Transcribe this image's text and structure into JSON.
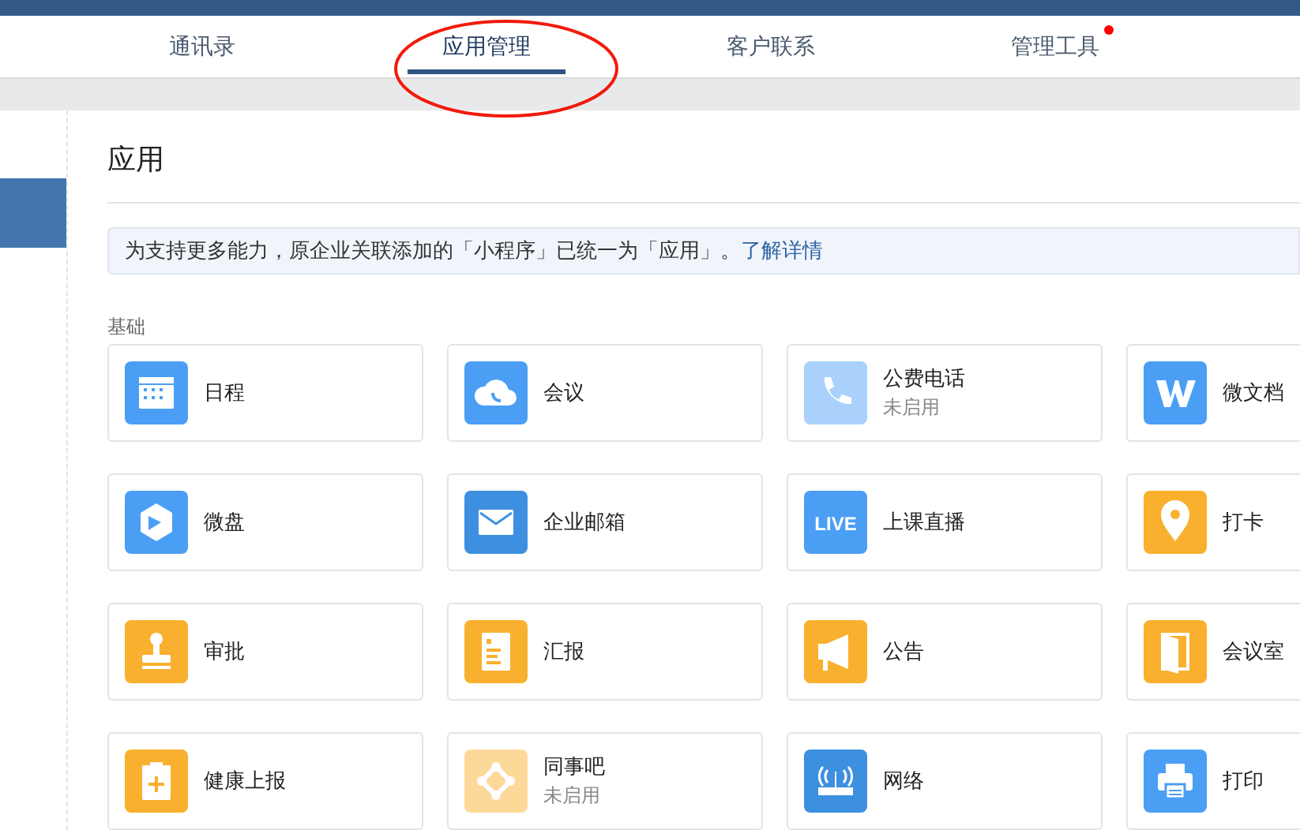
{
  "tabs": [
    {
      "label": "通讯录",
      "selected": false,
      "badge": false
    },
    {
      "label": "应用管理",
      "selected": true,
      "badge": false
    },
    {
      "label": "客户联系",
      "selected": false,
      "badge": false
    },
    {
      "label": "管理工具",
      "selected": false,
      "badge": true
    }
  ],
  "sidebar": {
    "items": [
      {
        "selected": true
      }
    ]
  },
  "page": {
    "title": "应用",
    "notice": {
      "text": "为支持更多能力，原企业关联添加的「小程序」已统一为「应用」。",
      "link": "了解详情"
    }
  },
  "section": {
    "title": "基础",
    "apps": [
      {
        "name": "日程",
        "kind": "calendar",
        "color": "#4a9ff5"
      },
      {
        "name": "会议",
        "kind": "cloud",
        "color": "#4a9ff5"
      },
      {
        "name": "公费电话",
        "kind": "phone",
        "color": "#a9d1fb",
        "status": "未启用"
      },
      {
        "name": "微文档",
        "kind": "w",
        "color": "#4a9ff5"
      },
      {
        "name": "微盘",
        "kind": "drive",
        "color": "#4a9ff5"
      },
      {
        "name": "企业邮箱",
        "kind": "mail",
        "color": "#3d8fe0"
      },
      {
        "name": "上课直播",
        "kind": "live",
        "color": "#4a9ff5",
        "icon_text": "LIVE"
      },
      {
        "name": "打卡",
        "kind": "pin",
        "color": "#f9b02e"
      },
      {
        "name": "审批",
        "kind": "stamp",
        "color": "#f9b02e"
      },
      {
        "name": "汇报",
        "kind": "report",
        "color": "#f9b02e"
      },
      {
        "name": "公告",
        "kind": "megaphone",
        "color": "#f9b02e"
      },
      {
        "name": "会议室",
        "kind": "door",
        "color": "#f9b02e"
      },
      {
        "name": "健康上报",
        "kind": "clipboard",
        "color": "#f9b02e"
      },
      {
        "name": "同事吧",
        "kind": "nodes",
        "color": "#fdd999",
        "status": "未启用"
      },
      {
        "name": "网络",
        "kind": "router",
        "color": "#3d8fe0"
      },
      {
        "name": "打印",
        "kind": "printer",
        "color": "#4a9ff5"
      }
    ]
  }
}
